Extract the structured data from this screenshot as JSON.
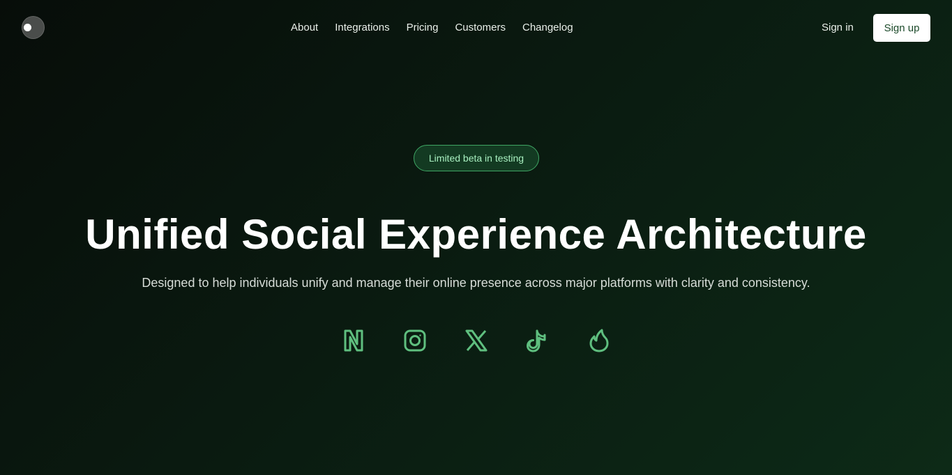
{
  "nav": {
    "links": [
      "About",
      "Integrations",
      "Pricing",
      "Customers",
      "Changelog"
    ],
    "sign_in": "Sign in",
    "sign_up": "Sign up"
  },
  "hero": {
    "badge": "Limited beta in testing",
    "title": "Unified Social Experience Architecture",
    "subtitle": "Designed to help individuals unify and manage their online presence across major platforms with clarity and consistency."
  },
  "platform_icons": [
    "threads-icon",
    "instagram-icon",
    "x-icon",
    "tiktok-icon",
    "tinder-icon"
  ],
  "colors": {
    "accent": "#5fbf7f",
    "badge_border": "#3fa664",
    "badge_text": "#a8f0c0",
    "background": "#0a1a10"
  }
}
